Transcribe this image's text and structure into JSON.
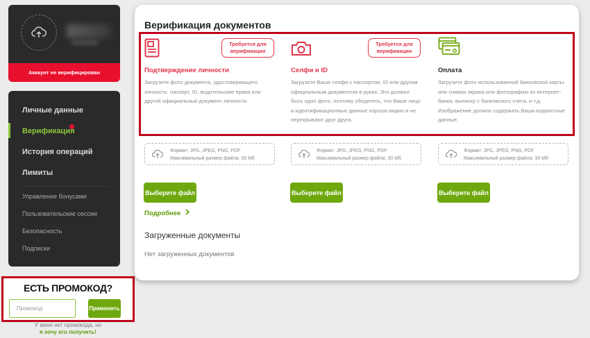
{
  "profile": {
    "status_label": "Аккаунт не верифицирован"
  },
  "nav": {
    "items": [
      {
        "label": "Личные данные"
      },
      {
        "label": "Верификация"
      },
      {
        "label": "История операций"
      },
      {
        "label": "Лимиты"
      }
    ],
    "sub_items": [
      {
        "label": "Управление бонусами"
      },
      {
        "label": "Пользовательские сессии"
      },
      {
        "label": "Безопасность"
      },
      {
        "label": "Подписки"
      }
    ]
  },
  "promo": {
    "title": "ЕСТЬ ПРОМОКОД?",
    "placeholder": "Промокод",
    "apply_label": "Применить",
    "no_code_text": "У меня нет промокода, но",
    "get_code_link": "я хочу его получить!"
  },
  "main": {
    "title": "Верификация документов",
    "columns": [
      {
        "icon": "id-document-icon",
        "badge": "Требуется для верификации",
        "title": "Подтверждение личности",
        "title_color": "#e0334a",
        "description": "Загрузите фото документа, удостоверяющего личность: паспорт, ID, водительские права или другой официальный документ личности."
      },
      {
        "icon": "camera-icon",
        "badge": "Требуется для верификации",
        "title": "Селфи и ID",
        "title_color": "#e0334a",
        "description": "Загрузите Ваше селфи с паспортом, ID или другим официальным документом в руках. Это должно быть одно фото, поэтому убедитесь, что Ваше лицо и идентификационные данные хорошо видно и не перекрывают друг друга."
      },
      {
        "icon": "bank-card-icon",
        "badge": "",
        "title": "Оплата",
        "title_color": "#222222",
        "description": "Загрузите фото использованной банковской карты или снимок экрана или фотографию из интернет-банка, выписку с банковского счета, и т.д. Изображение должно содержать Ваши корректные данные."
      }
    ],
    "upload": {
      "format_line": "Формат: JPG, JPEG, PNG, PDF",
      "size_line": "Максимальный размер файла: 30 Мб",
      "button_label": "Выберите файл"
    },
    "more_link": "Подробнее",
    "uploaded_title": "Загруженные документы",
    "no_docs": "Нет загруженных документов"
  },
  "colors": {
    "accent_green": "#6fa80e",
    "alert_red": "#e8102d",
    "highlight_border": "#c0061b",
    "sidebar_bg": "#2a2a2a"
  }
}
